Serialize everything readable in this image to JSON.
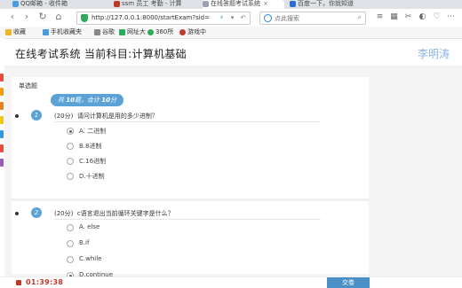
{
  "browser": {
    "tabs": [
      {
        "label": "QQ邮箱 - 收件箱",
        "color": "#4a9be0"
      },
      {
        "label": "ssm 员工 考勤 - 计算",
        "color": "#c0392b"
      },
      {
        "label": "在线答题考试系统",
        "color": "#9aa2ad"
      },
      {
        "label": "百度一下，你就知道",
        "color": "#2a6fd6"
      }
    ],
    "url": "http://127.0.0.1:8000/startExam?sid=",
    "search_placeholder": "点此搜索",
    "bookmarks": [
      {
        "label": "收藏",
        "color": "#f0b429"
      },
      {
        "label": "手机收藏夹",
        "color": "#4a9be0"
      },
      {
        "label": "谷歌",
        "color": "#888888"
      },
      {
        "label": "网址大",
        "color": "#2eaa5c"
      },
      {
        "label": "360所",
        "color": "#2eaa5c"
      },
      {
        "label": "游戏中",
        "color": "#c0392b"
      }
    ]
  },
  "header": {
    "title": "在线考试系统  当前科目:计算机基础",
    "username": "李明涛"
  },
  "section": {
    "type_label": "单选题",
    "total": "10",
    "points": "10"
  },
  "questions": [
    {
      "number": "1",
      "score": "(20分)",
      "text": "请问计算机是用的多少进制？",
      "options": [
        {
          "label": "A. 二进制",
          "checked": true
        },
        {
          "label": "B.8进制",
          "checked": false
        },
        {
          "label": "C.16进制",
          "checked": false
        },
        {
          "label": "D.十进制",
          "checked": false
        }
      ]
    },
    {
      "number": "2",
      "score": "(20分)",
      "text": "c语言退出当前循环关键字是什么？",
      "options": [
        {
          "label": "A. else",
          "checked": false
        },
        {
          "label": "B.if",
          "checked": false
        },
        {
          "label": "C.while",
          "checked": false
        },
        {
          "label": "D.continue",
          "checked": true
        }
      ]
    }
  ],
  "footer": {
    "timer": "01:39:38",
    "submit_label": "交卷"
  },
  "colors": {
    "accent": "#5ba3d6",
    "timer": "#c0392b",
    "submit": "#4a8fc5"
  }
}
